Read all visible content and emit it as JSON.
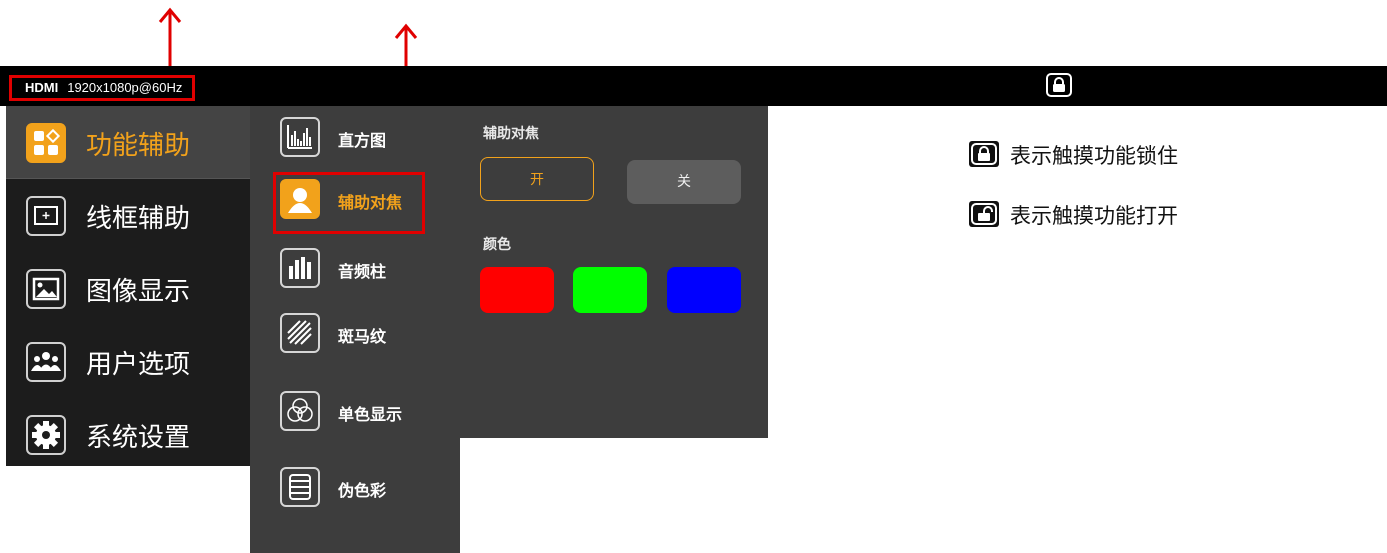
{
  "status_bar": {
    "source": "HDMI",
    "resolution": "1920x1080p@60Hz",
    "lock_icon": "lock-icon"
  },
  "main_menu": {
    "items": [
      {
        "label": "功能辅助",
        "icon": "function-assist-icon",
        "active": true
      },
      {
        "label": "线框辅助",
        "icon": "frame-assist-icon",
        "active": false
      },
      {
        "label": "图像显示",
        "icon": "image-display-icon",
        "active": false
      },
      {
        "label": "用户选项",
        "icon": "user-options-icon",
        "active": false
      },
      {
        "label": "系统设置",
        "icon": "gear-icon",
        "active": false
      }
    ]
  },
  "sub_menu": {
    "items": [
      {
        "label": "直方图",
        "icon": "histogram-icon",
        "active": false
      },
      {
        "label": "辅助对焦",
        "icon": "focus-assist-icon",
        "active": true
      },
      {
        "label": "音频柱",
        "icon": "audio-meter-icon",
        "active": false
      },
      {
        "label": "斑马纹",
        "icon": "zebra-icon",
        "active": false
      },
      {
        "label": "单色显示",
        "icon": "mono-display-icon",
        "active": false
      },
      {
        "label": "伪色彩",
        "icon": "false-color-icon",
        "active": false
      }
    ]
  },
  "panel": {
    "focus_title": "辅助对焦",
    "on_label": "开",
    "off_label": "关",
    "color_title": "颜色",
    "colors": [
      "#ff0000",
      "#00ff00",
      "#0000ff"
    ]
  },
  "legend": {
    "locked_text": "表示触摸功能锁住",
    "unlocked_text": "表示触摸功能打开"
  },
  "colors": {
    "accent": "#f2a21b",
    "highlight": "#e00000"
  }
}
